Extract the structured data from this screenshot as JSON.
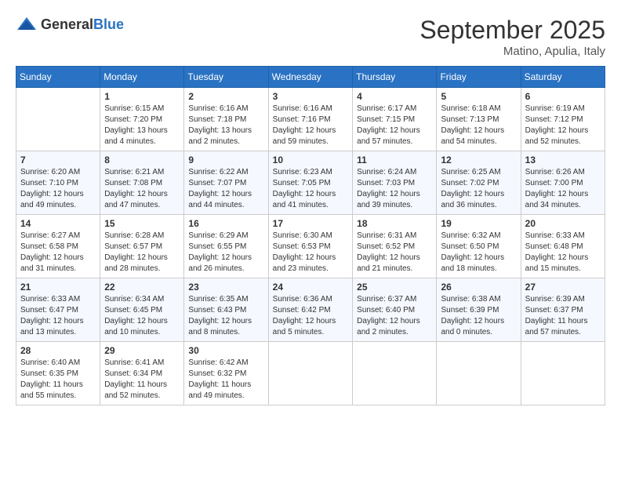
{
  "header": {
    "logo_general": "General",
    "logo_blue": "Blue",
    "month": "September 2025",
    "location": "Matino, Apulia, Italy"
  },
  "days_of_week": [
    "Sunday",
    "Monday",
    "Tuesday",
    "Wednesday",
    "Thursday",
    "Friday",
    "Saturday"
  ],
  "weeks": [
    [
      {
        "day": "",
        "info": ""
      },
      {
        "day": "1",
        "info": "Sunrise: 6:15 AM\nSunset: 7:20 PM\nDaylight: 13 hours\nand 4 minutes."
      },
      {
        "day": "2",
        "info": "Sunrise: 6:16 AM\nSunset: 7:18 PM\nDaylight: 13 hours\nand 2 minutes."
      },
      {
        "day": "3",
        "info": "Sunrise: 6:16 AM\nSunset: 7:16 PM\nDaylight: 12 hours\nand 59 minutes."
      },
      {
        "day": "4",
        "info": "Sunrise: 6:17 AM\nSunset: 7:15 PM\nDaylight: 12 hours\nand 57 minutes."
      },
      {
        "day": "5",
        "info": "Sunrise: 6:18 AM\nSunset: 7:13 PM\nDaylight: 12 hours\nand 54 minutes."
      },
      {
        "day": "6",
        "info": "Sunrise: 6:19 AM\nSunset: 7:12 PM\nDaylight: 12 hours\nand 52 minutes."
      }
    ],
    [
      {
        "day": "7",
        "info": "Sunrise: 6:20 AM\nSunset: 7:10 PM\nDaylight: 12 hours\nand 49 minutes."
      },
      {
        "day": "8",
        "info": "Sunrise: 6:21 AM\nSunset: 7:08 PM\nDaylight: 12 hours\nand 47 minutes."
      },
      {
        "day": "9",
        "info": "Sunrise: 6:22 AM\nSunset: 7:07 PM\nDaylight: 12 hours\nand 44 minutes."
      },
      {
        "day": "10",
        "info": "Sunrise: 6:23 AM\nSunset: 7:05 PM\nDaylight: 12 hours\nand 41 minutes."
      },
      {
        "day": "11",
        "info": "Sunrise: 6:24 AM\nSunset: 7:03 PM\nDaylight: 12 hours\nand 39 minutes."
      },
      {
        "day": "12",
        "info": "Sunrise: 6:25 AM\nSunset: 7:02 PM\nDaylight: 12 hours\nand 36 minutes."
      },
      {
        "day": "13",
        "info": "Sunrise: 6:26 AM\nSunset: 7:00 PM\nDaylight: 12 hours\nand 34 minutes."
      }
    ],
    [
      {
        "day": "14",
        "info": "Sunrise: 6:27 AM\nSunset: 6:58 PM\nDaylight: 12 hours\nand 31 minutes."
      },
      {
        "day": "15",
        "info": "Sunrise: 6:28 AM\nSunset: 6:57 PM\nDaylight: 12 hours\nand 28 minutes."
      },
      {
        "day": "16",
        "info": "Sunrise: 6:29 AM\nSunset: 6:55 PM\nDaylight: 12 hours\nand 26 minutes."
      },
      {
        "day": "17",
        "info": "Sunrise: 6:30 AM\nSunset: 6:53 PM\nDaylight: 12 hours\nand 23 minutes."
      },
      {
        "day": "18",
        "info": "Sunrise: 6:31 AM\nSunset: 6:52 PM\nDaylight: 12 hours\nand 21 minutes."
      },
      {
        "day": "19",
        "info": "Sunrise: 6:32 AM\nSunset: 6:50 PM\nDaylight: 12 hours\nand 18 minutes."
      },
      {
        "day": "20",
        "info": "Sunrise: 6:33 AM\nSunset: 6:48 PM\nDaylight: 12 hours\nand 15 minutes."
      }
    ],
    [
      {
        "day": "21",
        "info": "Sunrise: 6:33 AM\nSunset: 6:47 PM\nDaylight: 12 hours\nand 13 minutes."
      },
      {
        "day": "22",
        "info": "Sunrise: 6:34 AM\nSunset: 6:45 PM\nDaylight: 12 hours\nand 10 minutes."
      },
      {
        "day": "23",
        "info": "Sunrise: 6:35 AM\nSunset: 6:43 PM\nDaylight: 12 hours\nand 8 minutes."
      },
      {
        "day": "24",
        "info": "Sunrise: 6:36 AM\nSunset: 6:42 PM\nDaylight: 12 hours\nand 5 minutes."
      },
      {
        "day": "25",
        "info": "Sunrise: 6:37 AM\nSunset: 6:40 PM\nDaylight: 12 hours\nand 2 minutes."
      },
      {
        "day": "26",
        "info": "Sunrise: 6:38 AM\nSunset: 6:39 PM\nDaylight: 12 hours\nand 0 minutes."
      },
      {
        "day": "27",
        "info": "Sunrise: 6:39 AM\nSunset: 6:37 PM\nDaylight: 11 hours\nand 57 minutes."
      }
    ],
    [
      {
        "day": "28",
        "info": "Sunrise: 6:40 AM\nSunset: 6:35 PM\nDaylight: 11 hours\nand 55 minutes."
      },
      {
        "day": "29",
        "info": "Sunrise: 6:41 AM\nSunset: 6:34 PM\nDaylight: 11 hours\nand 52 minutes."
      },
      {
        "day": "30",
        "info": "Sunrise: 6:42 AM\nSunset: 6:32 PM\nDaylight: 11 hours\nand 49 minutes."
      },
      {
        "day": "",
        "info": ""
      },
      {
        "day": "",
        "info": ""
      },
      {
        "day": "",
        "info": ""
      },
      {
        "day": "",
        "info": ""
      }
    ]
  ]
}
